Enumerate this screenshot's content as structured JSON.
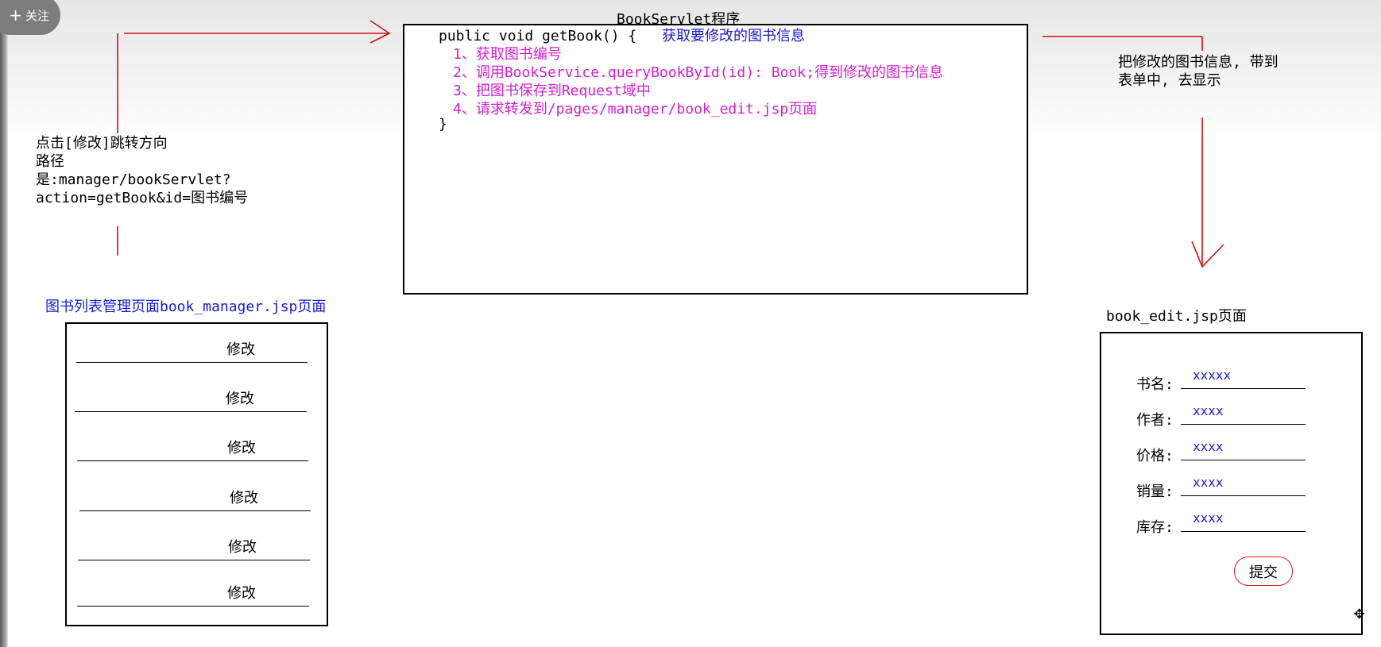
{
  "ui": {
    "follow_label": "关注"
  },
  "servlet": {
    "title": "BookServlet程序",
    "signature": "public void getBook() {",
    "comment": "获取要修改的图书信息",
    "steps": [
      "1、获取图书编号",
      "2、调用BookService.queryBookById(id): Book;得到修改的图书信息",
      "3、把图书保存到Request域中",
      "4、请求转发到/pages/manager/book_edit.jsp页面"
    ],
    "close_brace": "}"
  },
  "left_note": {
    "lines": [
      "点击[修改]跳转方向",
      "路径",
      "是:manager/bookServlet?",
      "action=getBook&id=图书编号"
    ]
  },
  "right_note": {
    "lines": [
      "把修改的图书信息, 带到",
      "表单中, 去显示"
    ]
  },
  "manager_page": {
    "title": "图书列表管理页面book_manager.jsp页面",
    "rows": [
      "修改",
      "修改",
      "修改",
      "修改",
      "修改",
      "修改"
    ]
  },
  "edit_page": {
    "title": "book_edit.jsp页面",
    "fields": [
      {
        "label": "书名:",
        "value": "xxxxx"
      },
      {
        "label": "作者:",
        "value": "xxxx"
      },
      {
        "label": "价格:",
        "value": "xxxx"
      },
      {
        "label": "销量:",
        "value": "xxxx"
      },
      {
        "label": "库存:",
        "value": "xxxx"
      }
    ],
    "submit_label": "提交"
  },
  "icons": {
    "move": "move-cursor-icon",
    "plus": "plus-icon"
  },
  "colors": {
    "arrow": "#cc1111",
    "code_step": "#d11fd1",
    "comment": "#1a1ad6",
    "value": "#1a1ad6"
  }
}
